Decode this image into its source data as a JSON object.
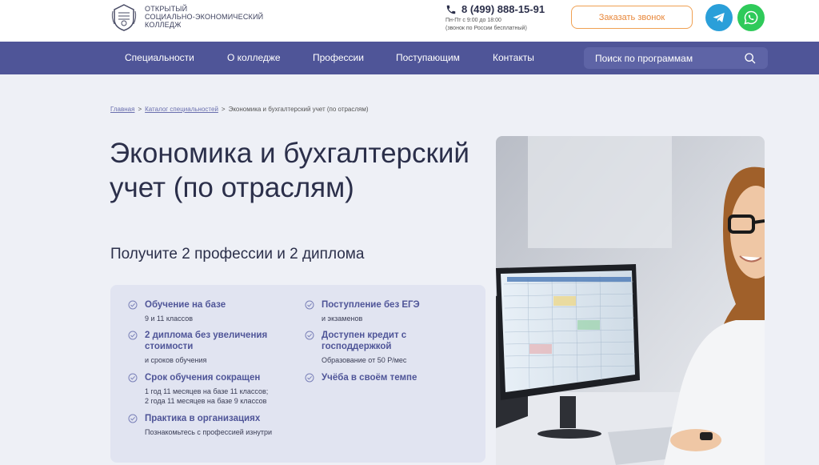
{
  "header": {
    "logo_lines": [
      "ОТКРЫТЫЙ",
      "СОЦИАЛЬНО-ЭКОНОМИЧЕСКИЙ",
      "КОЛЛЕДЖ"
    ],
    "phone": "8 (499) 888-15-91",
    "hours_line1": "Пн-Пт с 9:00 до 18:00",
    "hours_line2": "(звонок по России бесплатный)",
    "callback_label": "Заказать звонок"
  },
  "nav": {
    "items": [
      "Специальности",
      "О колледже",
      "Профессии",
      "Поступающим",
      "Контакты"
    ],
    "search_placeholder": "Поиск по программам"
  },
  "breadcrumb": {
    "home": "Главная",
    "sep": ">",
    "catalog": "Каталог специальностей",
    "current": "Экономика и бухгалтерский учет (по отраслям)"
  },
  "main": {
    "title": "Экономика и бухгалтерский учет (по отраслям)",
    "subtitle": "Получите 2 профессии и 2 диплома"
  },
  "benefits": [
    {
      "title": "Обучение на базе",
      "desc": "9 и 11 классов"
    },
    {
      "title": "2 диплома без увеличения стоимости",
      "desc": "и сроков обучения"
    },
    {
      "title": "Срок обучения сокращен",
      "desc": "1 год 11 месяцев на базе 11 классов;\n2 года 11 месяцев на базе 9 классов"
    },
    {
      "title": "Практика в организациях",
      "desc": "Познакомьтесь с профессией изнутри"
    },
    {
      "title": "Поступление без ЕГЭ",
      "desc": "и экзаменов"
    },
    {
      "title": "Доступен кредит с господдержкой",
      "desc": "Образование от 50 Р/мес"
    },
    {
      "title": "Учёба в своём темпе",
      "desc": ""
    }
  ],
  "colors": {
    "nav_bg": "#4f5598",
    "accent_orange": "#e8873a",
    "telegram": "#2a9fd9",
    "whatsapp": "#2fca5a",
    "benefit_title": "#4f5598"
  },
  "icons": [
    "college-emblem-icon",
    "phone-icon",
    "telegram-icon",
    "whatsapp-icon",
    "search-icon",
    "check-circle-icon"
  ]
}
